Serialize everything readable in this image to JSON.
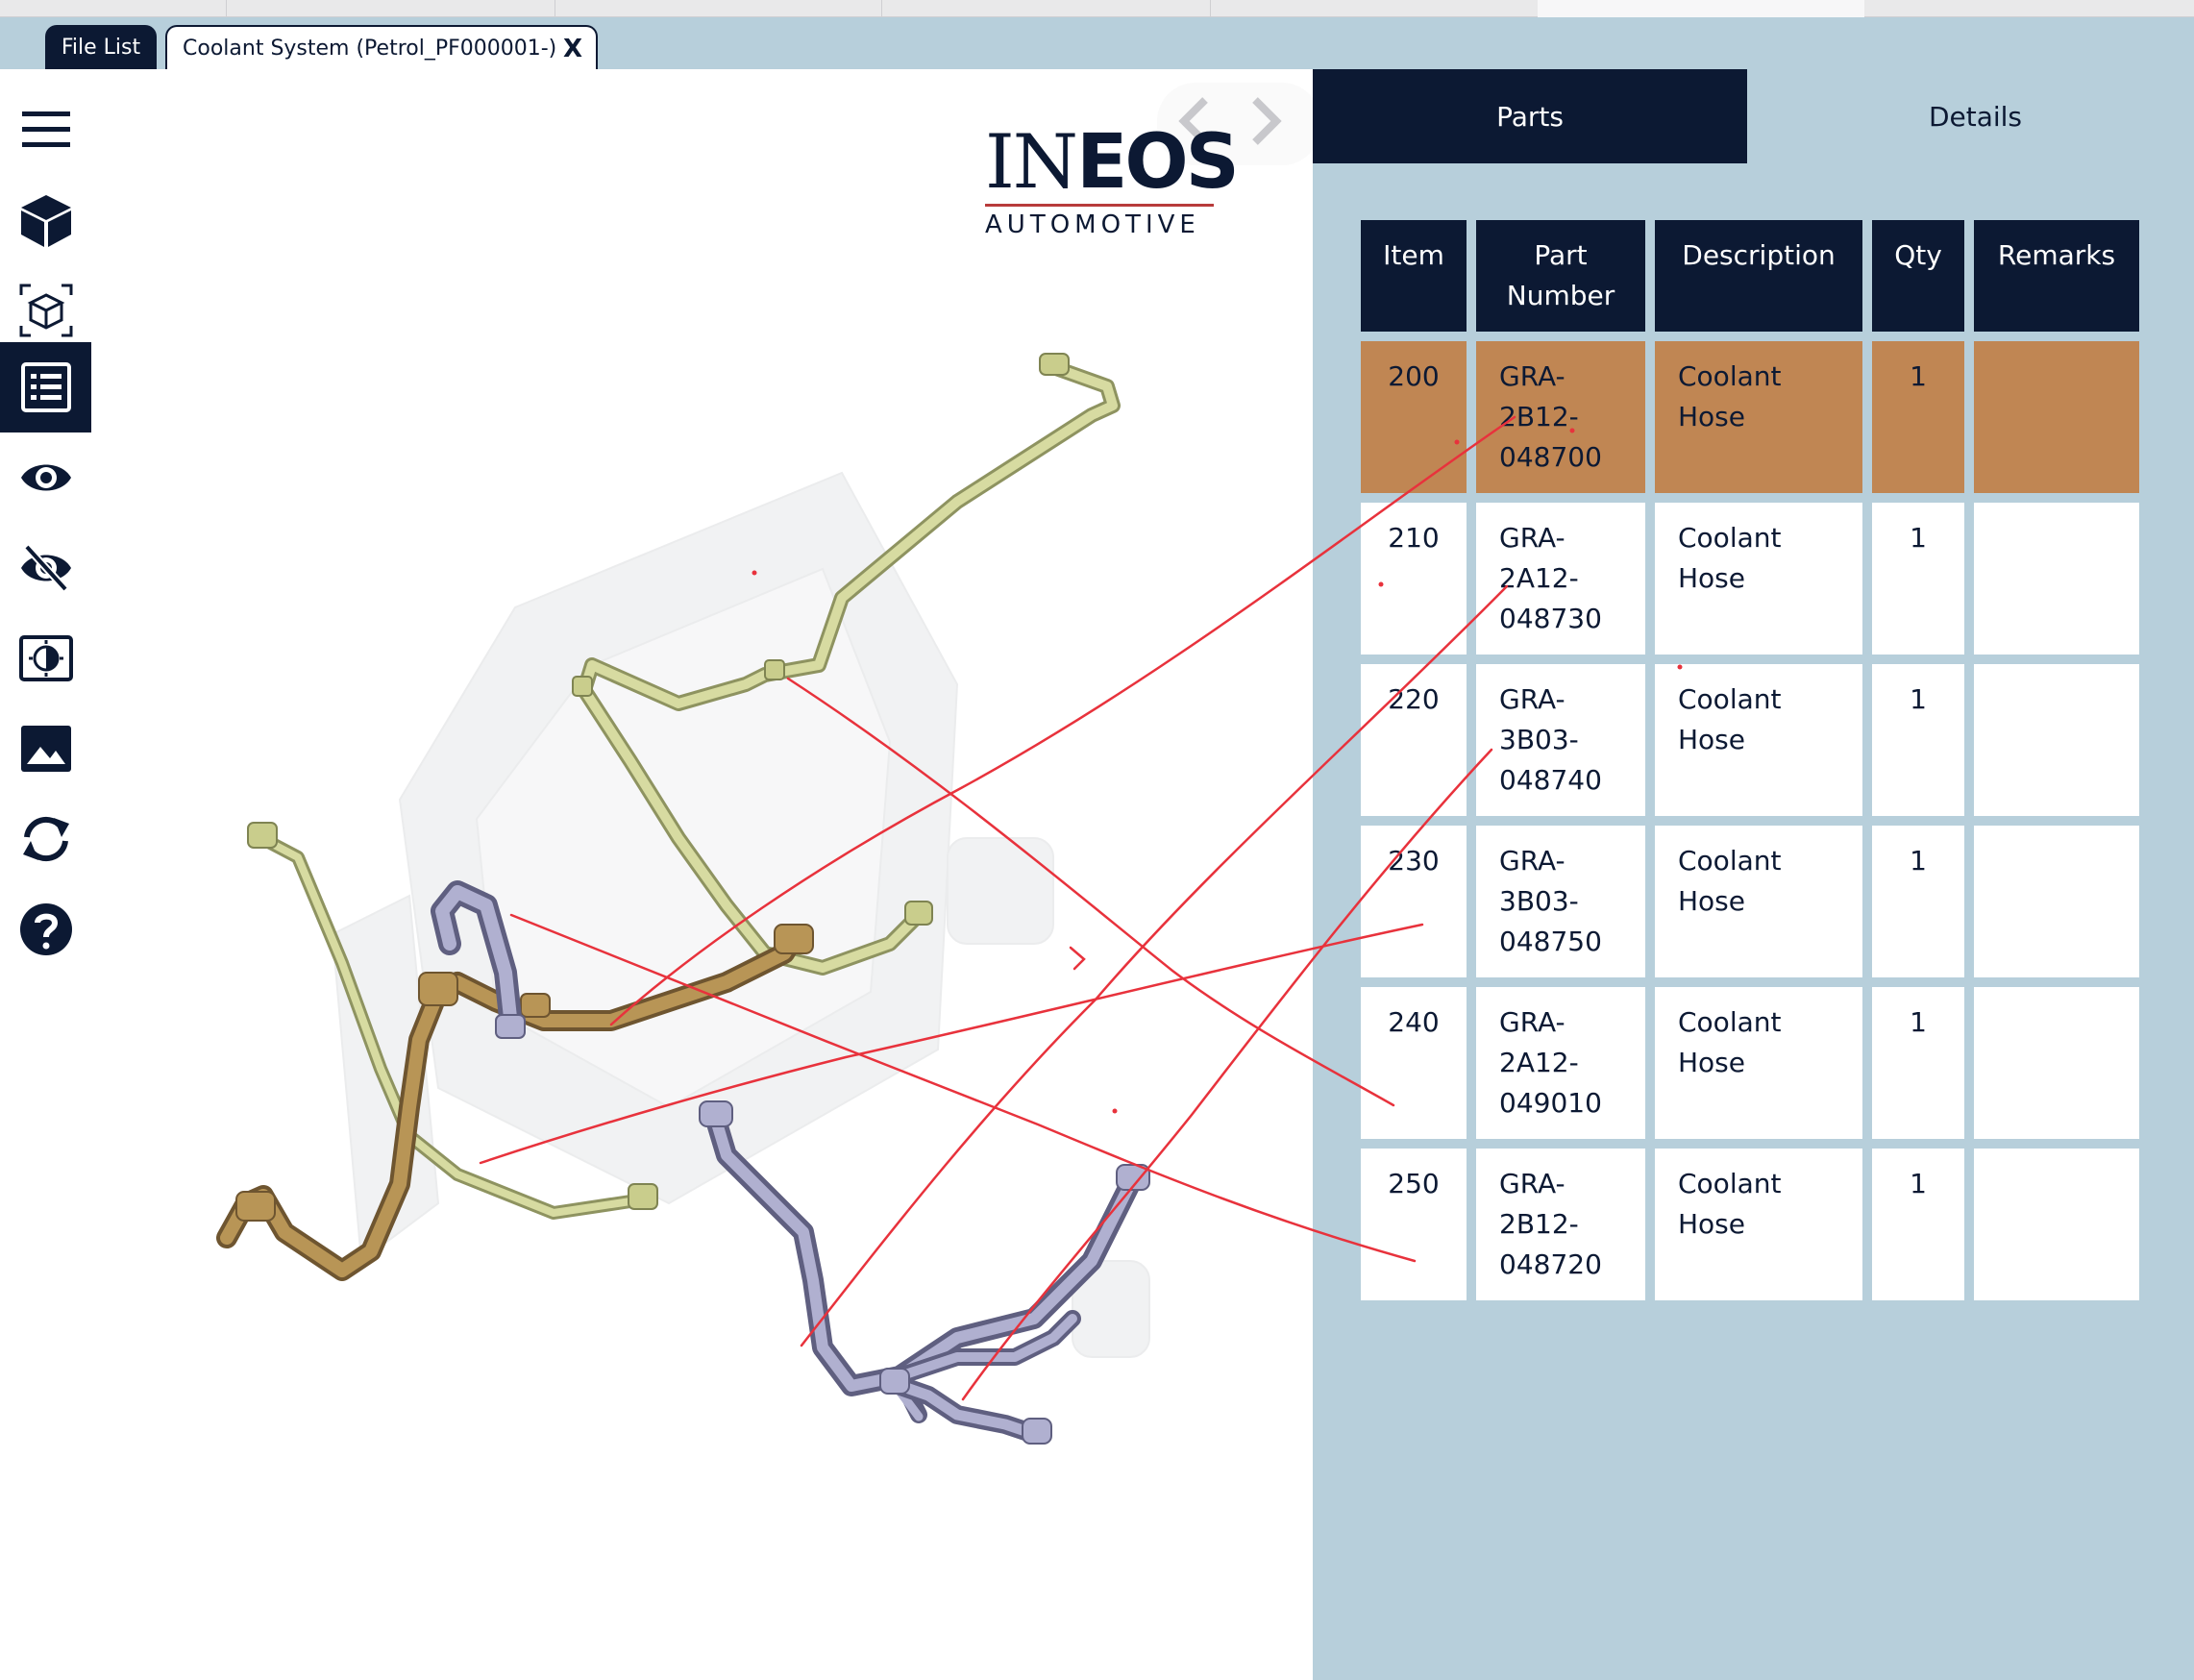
{
  "tabs": [
    {
      "label": "File List",
      "active": false
    },
    {
      "label": "Coolant System (Petrol_PF000001-)",
      "active": true
    }
  ],
  "tab_close_label": "X",
  "toolbar": [
    {
      "icon": "menu-icon",
      "active": false
    },
    {
      "icon": "cube-icon",
      "active": false
    },
    {
      "icon": "exploded-cube-icon",
      "active": false
    },
    {
      "icon": "parts-list-icon",
      "active": true
    },
    {
      "icon": "eye-icon",
      "active": false
    },
    {
      "icon": "eye-off-icon",
      "active": false
    },
    {
      "icon": "contrast-icon",
      "active": false
    },
    {
      "icon": "image-icon",
      "active": false
    },
    {
      "icon": "refresh-icon",
      "active": false
    },
    {
      "icon": "help-icon",
      "active": false
    }
  ],
  "logo": {
    "main": "INEOS",
    "sub": "AUTOMOTIVE"
  },
  "panel_tabs": [
    {
      "label": "Parts",
      "active": true
    },
    {
      "label": "Details",
      "active": false
    }
  ],
  "table": {
    "headers": {
      "item": "Item",
      "part_number": [
        "Part",
        "Number"
      ],
      "description": "Description",
      "qty": "Qty",
      "remarks": "Remarks"
    },
    "rows": [
      {
        "item": "200",
        "part": [
          "GRA-",
          "2B12-",
          "048700"
        ],
        "desc": [
          "Coolant",
          "Hose"
        ],
        "qty": "1",
        "remarks": "",
        "selected": true
      },
      {
        "item": "210",
        "part": [
          "GRA-",
          "2A12-",
          "048730"
        ],
        "desc": [
          "Coolant",
          "Hose"
        ],
        "qty": "1",
        "remarks": "",
        "selected": false
      },
      {
        "item": "220",
        "part": [
          "GRA-",
          "3B03-",
          "048740"
        ],
        "desc": [
          "Coolant",
          "Hose"
        ],
        "qty": "1",
        "remarks": "",
        "selected": false
      },
      {
        "item": "230",
        "part": [
          "GRA-",
          "3B03-",
          "048750"
        ],
        "desc": [
          "Coolant",
          "Hose"
        ],
        "qty": "1",
        "remarks": "",
        "selected": false
      },
      {
        "item": "240",
        "part": [
          "GRA-",
          "2A12-",
          "049010"
        ],
        "desc": [
          "Coolant",
          "Hose"
        ],
        "qty": "1",
        "remarks": "",
        "selected": false
      },
      {
        "item": "250",
        "part": [
          "GRA-",
          "2B12-",
          "048720"
        ],
        "desc": [
          "Coolant",
          "Hose"
        ],
        "qty": "1",
        "remarks": "",
        "selected": false
      }
    ]
  },
  "colors": {
    "navy": "#0c1933",
    "panel_bg": "#b7cfdb",
    "selected_row": "#c08653",
    "annotation": "#e8323c",
    "hose_yellow": "#c9cd8c",
    "hose_gold": "#a0824a",
    "hose_lilac": "#9c9cc0"
  }
}
